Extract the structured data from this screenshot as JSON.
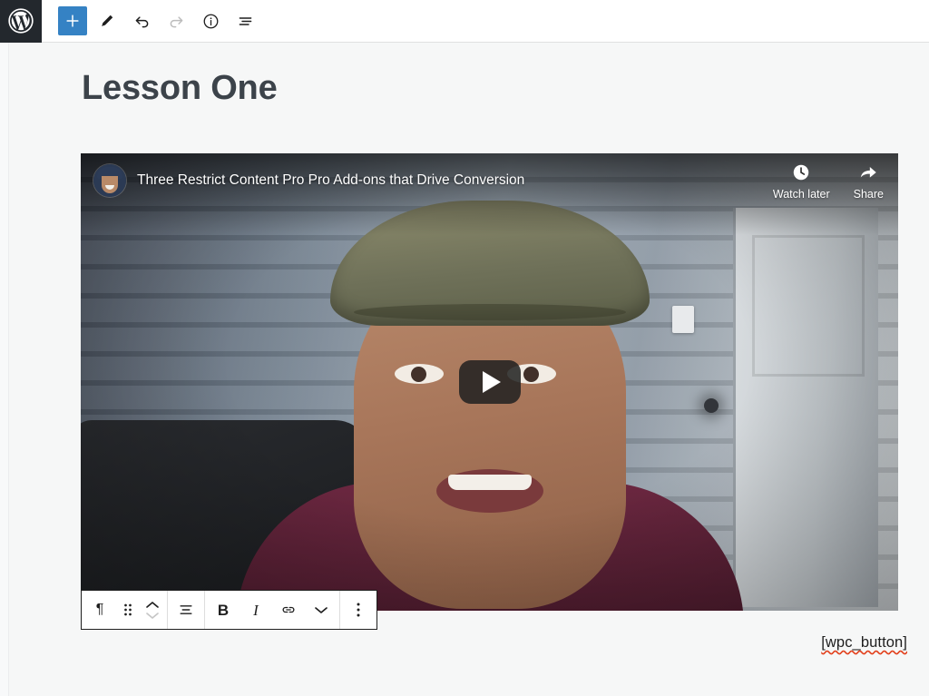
{
  "header": {
    "logo_icon": "wordpress-logo-icon",
    "tools": [
      {
        "name": "block-inserter-button",
        "icon": "plus-icon",
        "label": "Toggle block inserter",
        "state": "primary"
      },
      {
        "name": "tools-edit-button",
        "icon": "pencil-icon",
        "label": "Tools",
        "state": "default"
      },
      {
        "name": "undo-button",
        "icon": "undo-arrow-icon",
        "label": "Undo",
        "state": "default"
      },
      {
        "name": "redo-button",
        "icon": "redo-arrow-icon",
        "label": "Redo",
        "state": "disabled"
      },
      {
        "name": "details-button",
        "icon": "info-circle-icon",
        "label": "Details",
        "state": "default"
      },
      {
        "name": "list-view-button",
        "icon": "list-view-icon",
        "label": "List view",
        "state": "default"
      }
    ]
  },
  "editor": {
    "post_title": "Lesson One",
    "shortcode_text": "[wpc_button]"
  },
  "video": {
    "title": "Three Restrict Content Pro Pro Add-ons that Drive Conversion",
    "avatar_icon": "channel-avatar-icon",
    "play_icon": "play-button-icon",
    "actions": [
      {
        "name": "watch-later-action",
        "icon": "clock-icon",
        "label": "Watch later"
      },
      {
        "name": "share-action",
        "icon": "share-arrow-icon",
        "label": "Share"
      }
    ]
  },
  "block_toolbar": {
    "buttons": [
      {
        "name": "block-type-paragraph-button",
        "icon": "paragraph-pilcrow-icon",
        "label": "¶"
      },
      {
        "name": "drag-handle",
        "icon": "drag-dots-icon",
        "label": ""
      },
      {
        "name": "move-up-button",
        "icon": "chevron-up-icon",
        "label": ""
      },
      {
        "name": "move-down-button",
        "icon": "chevron-down-icon",
        "label": ""
      },
      {
        "name": "align-text-button",
        "icon": "align-text-icon",
        "label": ""
      },
      {
        "name": "bold-button",
        "icon": "bold-icon",
        "label": "B"
      },
      {
        "name": "italic-button",
        "icon": "italic-icon",
        "label": "I"
      },
      {
        "name": "link-button",
        "icon": "link-chain-icon",
        "label": ""
      },
      {
        "name": "more-rich-text-button",
        "icon": "chevron-down-icon",
        "label": ""
      },
      {
        "name": "block-options-button",
        "icon": "vertical-ellipsis-icon",
        "label": ""
      }
    ]
  },
  "colors": {
    "accent": "#3582c4",
    "wp_logo_bg": "#23282d",
    "canvas_bg": "#f6f7f7",
    "title_text": "#3c434a",
    "spellcheck_underline": "#e2401c"
  }
}
